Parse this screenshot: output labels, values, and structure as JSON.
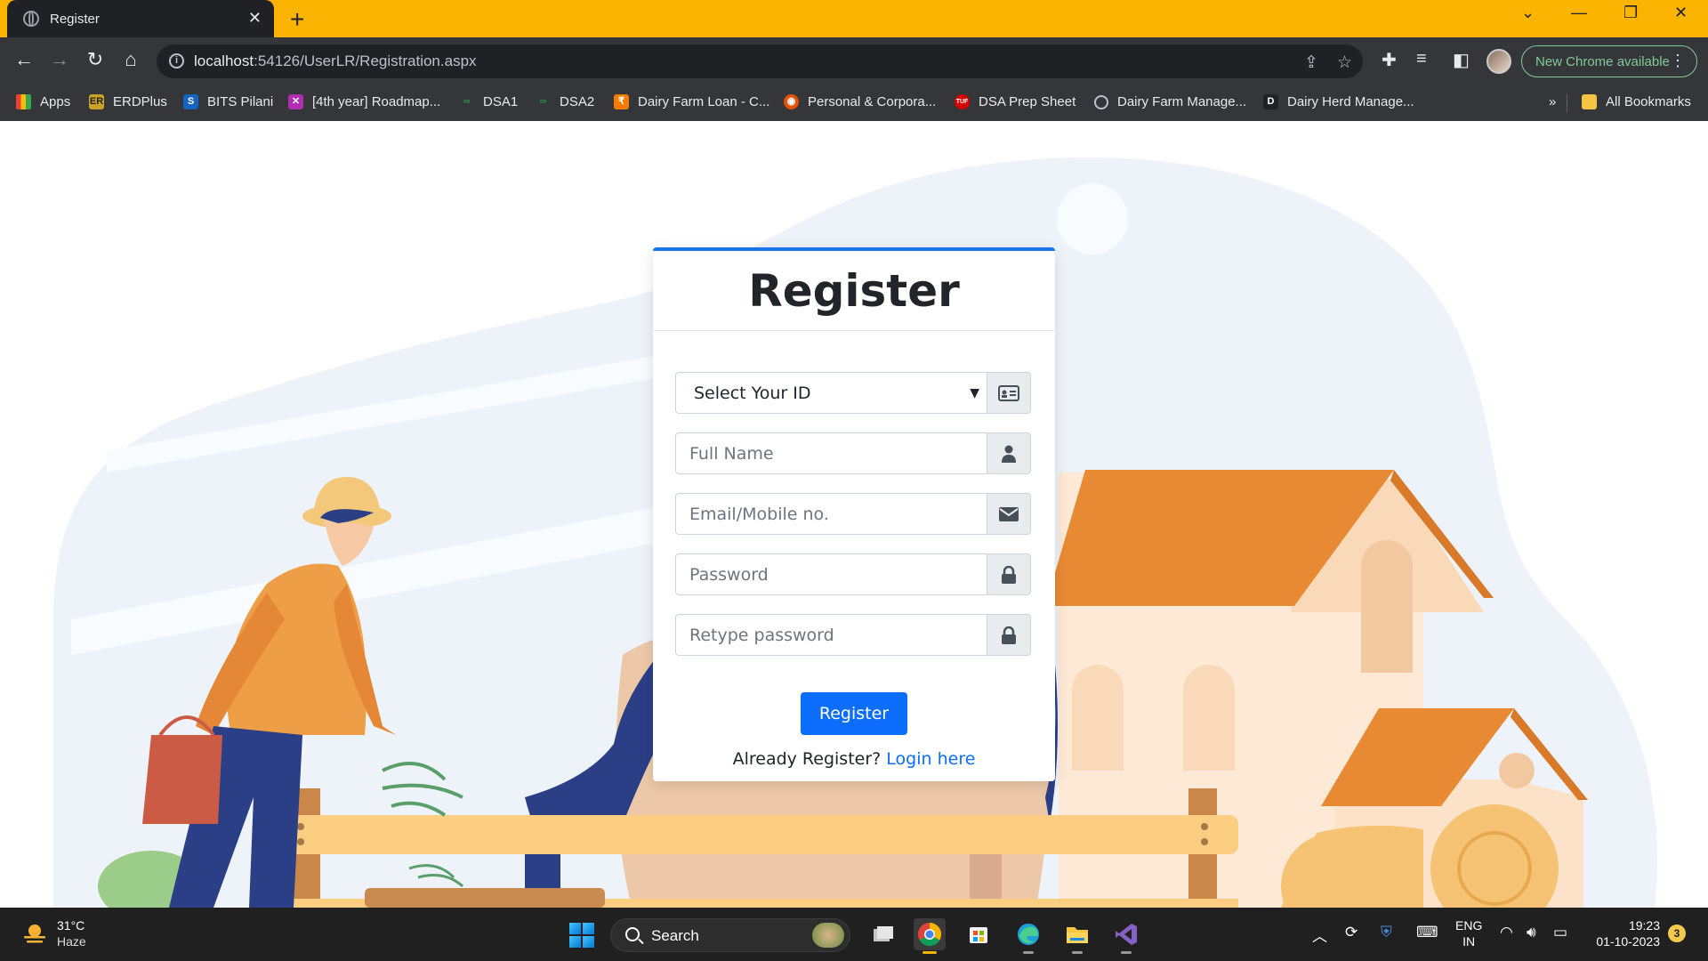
{
  "browser": {
    "tab_title": "Register",
    "url_host": "localhost",
    "url_rest": ":54126/UserLR/Registration.aspx",
    "new_chrome_label": "New Chrome available",
    "accent": "#fbb402"
  },
  "bookmarks": {
    "items": [
      {
        "label": "Apps",
        "icon": "apps-grid-icon"
      },
      {
        "label": "ERDPlus",
        "icon": "erdplus-icon"
      },
      {
        "label": "BITS Pilani",
        "icon": "bits-icon"
      },
      {
        "label": "[4th year] Roadmap...",
        "icon": "roadmap-icon"
      },
      {
        "label": "DSA1",
        "icon": "dsa-icon"
      },
      {
        "label": "DSA2",
        "icon": "dsa-icon"
      },
      {
        "label": "Dairy Farm Loan - C...",
        "icon": "loan-icon"
      },
      {
        "label": "Personal & Corpora...",
        "icon": "bank-icon"
      },
      {
        "label": "DSA Prep Sheet",
        "icon": "tuf-icon"
      },
      {
        "label": "Dairy Farm Manage...",
        "icon": "globe-icon"
      },
      {
        "label": "Dairy Herd Manage...",
        "icon": "d-icon"
      }
    ],
    "more": "»",
    "all_bookmarks": "All Bookmarks"
  },
  "form": {
    "title": "Register",
    "id_select": {
      "selected": "Select Your ID"
    },
    "full_name_placeholder": "Full Name",
    "email_placeholder": "Email/Mobile no.",
    "password_placeholder": "Password",
    "retype_placeholder": "Retype password",
    "submit_label": "Register",
    "already_text": "Already Register?",
    "login_link": "Login here",
    "primary_color": "#0d6efd"
  },
  "taskbar": {
    "temperature": "31°C",
    "weather": "Haze",
    "search_label": "Search",
    "lang_top": "ENG",
    "lang_bottom": "IN",
    "time": "19:23",
    "date": "01-10-2023",
    "notifications": "3"
  }
}
